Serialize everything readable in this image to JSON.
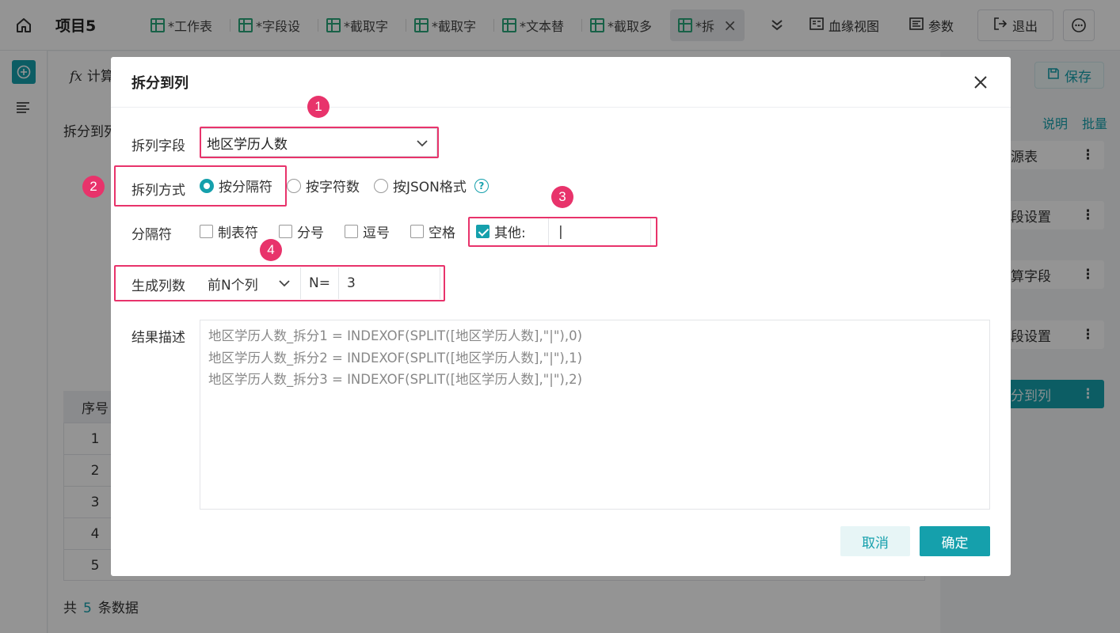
{
  "header": {
    "project_title": "项目5",
    "tabs": [
      {
        "label": "*工作表"
      },
      {
        "label": "*字段设"
      },
      {
        "label": "*截取字"
      },
      {
        "label": "*截取字"
      },
      {
        "label": "*文本替"
      },
      {
        "label": "*截取多"
      },
      {
        "label": "*拆"
      }
    ],
    "lineage_label": "血缘视图",
    "params_label": "参数",
    "exit_label": "退出"
  },
  "main": {
    "calc_label": "计算",
    "split_label": "拆分到列",
    "table": {
      "header": "序号",
      "rows": [
        "1",
        "2",
        "3",
        "4",
        "5"
      ]
    },
    "footer": {
      "prefix": "共",
      "count": "5",
      "suffix": "条数据"
    }
  },
  "right_panel": {
    "save_label": "保存",
    "help_label": "说明",
    "batch_label": "批量",
    "steps": [
      {
        "label": "源表"
      },
      {
        "label": "段设置"
      },
      {
        "label": "算字段"
      },
      {
        "label": "段设置"
      },
      {
        "label": "分到列"
      }
    ]
  },
  "dialog": {
    "title": "拆分到列",
    "field_label": "拆列字段",
    "field_value": "地区学历人数",
    "method_label": "拆列方式",
    "methods": [
      "按分隔符",
      "按字符数",
      "按JSON格式"
    ],
    "delimiter_label": "分隔符",
    "delimiters": [
      "制表符",
      "分号",
      "逗号",
      "空格",
      "其他:"
    ],
    "other_value": "|",
    "gen_label": "生成列数",
    "gen_mode": "前N个列",
    "n_label": "N=",
    "n_value": "3",
    "result_label": "结果描述",
    "result_lines": [
      "地区学历人数_拆分1 = INDEXOF(SPLIT([地区学历人数],\"|\"),0)",
      "地区学历人数_拆分2 = INDEXOF(SPLIT([地区学历人数],\"|\"),1)",
      "地区学历人数_拆分3 = INDEXOF(SPLIT([地区学历人数],\"|\"),2)"
    ],
    "cancel_label": "取消",
    "ok_label": "确定"
  },
  "annotations": {
    "markers": [
      "1",
      "2",
      "3",
      "4"
    ]
  },
  "colors": {
    "accent": "#15a0ac",
    "highlight": "#e8336b"
  }
}
